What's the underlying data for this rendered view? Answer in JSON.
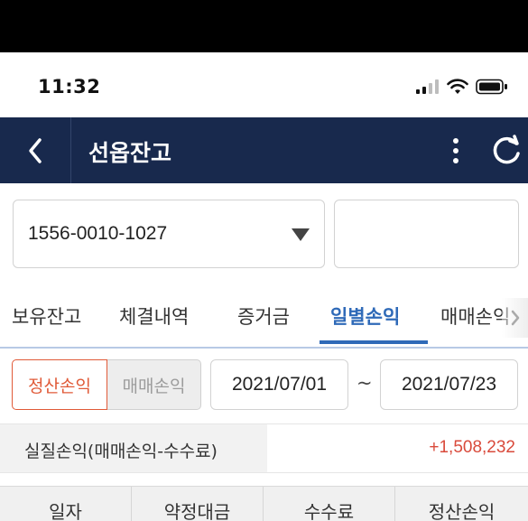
{
  "status": {
    "time": "11:32"
  },
  "header": {
    "title": "선옵잔고"
  },
  "account": {
    "number": "1556-0010-1027",
    "password_placeholder": ""
  },
  "tabs": [
    {
      "label": "보유잔고",
      "active": false
    },
    {
      "label": "체결내역",
      "active": false
    },
    {
      "label": "증거금",
      "active": false
    },
    {
      "label": "일별손익",
      "active": true
    },
    {
      "label": "매매손익",
      "active": false
    }
  ],
  "filter": {
    "segments": [
      {
        "label": "정산손익",
        "selected": true
      },
      {
        "label": "매매손익",
        "selected": false
      }
    ],
    "date_from": "2021/07/01",
    "separator": "~",
    "date_to": "2021/07/23"
  },
  "summary": {
    "label": "실질손익(매매손익-수수료)",
    "value": "+1,508,232"
  },
  "table": {
    "columns": [
      "일자",
      "약정대금",
      "수수료",
      "정산손익"
    ]
  },
  "colors": {
    "navbar": "#18294d",
    "accent": "#2f6ab8",
    "profit": "#d94a3b",
    "segment_active": "#e05a38"
  },
  "icons": [
    "signal-icon",
    "wifi-icon",
    "battery-icon",
    "back-chevron-icon",
    "more-vertical-icon",
    "refresh-icon",
    "caret-down-icon",
    "chevron-right-icon"
  ]
}
